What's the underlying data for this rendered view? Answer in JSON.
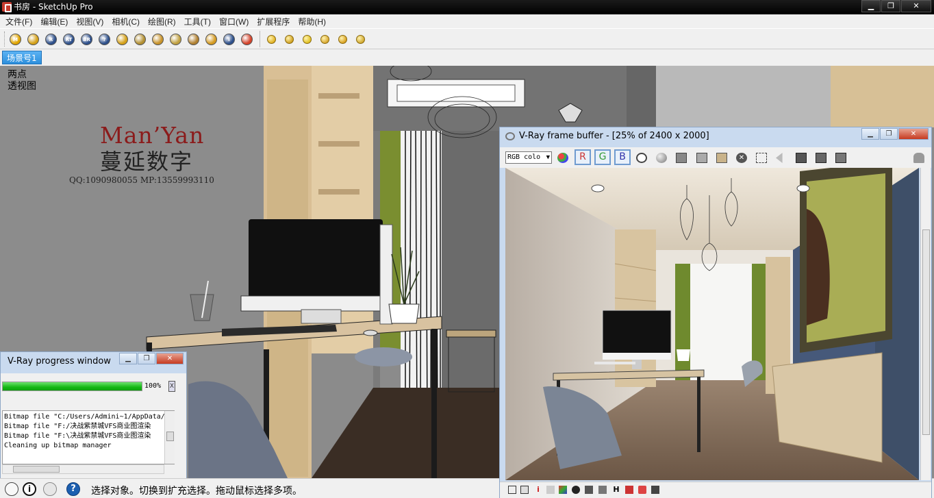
{
  "window": {
    "title": "书房 - SketchUp Pro",
    "btn_min": "▁",
    "btn_max": "❐",
    "btn_close": "✕"
  },
  "menu": [
    "文件(F)",
    "编辑(E)",
    "视图(V)",
    "相机(C)",
    "绘图(R)",
    "工具(T)",
    "窗口(W)",
    "扩展程序",
    "帮助(H)"
  ],
  "toolbar_icons": [
    {
      "name": "vray-material-editor-icon",
      "label": "M",
      "color": "#e0a400"
    },
    {
      "name": "vray-options-icon",
      "label": "",
      "color": "#d4a017"
    },
    {
      "name": "vray-render-icon",
      "label": "R",
      "color": "#2d4f8a"
    },
    {
      "name": "vray-rt-render-icon",
      "label": "RT",
      "color": "#2d4f8a"
    },
    {
      "name": "vray-batch-render-icon",
      "label": "BR",
      "color": "#2d4f8a"
    },
    {
      "name": "vray-help-icon",
      "label": "?",
      "color": "#2d4f8a"
    },
    {
      "name": "vray-frame-buffer-icon",
      "label": "",
      "color": "#d4a017"
    },
    {
      "name": "vray-export-icon",
      "label": "",
      "color": "#b39032"
    },
    {
      "name": "vray-light-cache-icon",
      "label": "",
      "color": "#c8932a"
    },
    {
      "name": "vray-proxy-icon",
      "label": "",
      "color": "#c0a040"
    },
    {
      "name": "vray-fur-icon",
      "label": "",
      "color": "#b08030"
    },
    {
      "name": "vray-sphere-icon",
      "label": "",
      "color": "#d49a20"
    },
    {
      "name": "vray-info-icon",
      "label": "i",
      "color": "#2d4f8a"
    },
    {
      "name": "vray-logo-icon",
      "label": "",
      "color": "#d4432a"
    }
  ],
  "toolbar_icons2": [
    {
      "name": "omni-light-icon",
      "color": "#e0b020"
    },
    {
      "name": "spot-light-icon",
      "color": "#d0a020"
    },
    {
      "name": "rect-light-icon",
      "color": "#e0c020"
    },
    {
      "name": "sphere-light-icon",
      "color": "#d8a830"
    },
    {
      "name": "ies-light-icon",
      "color": "#d8a020"
    },
    {
      "name": "dome-light-icon",
      "color": "#d0a830"
    }
  ],
  "scene_tab": "场景号1",
  "viewport": {
    "label_line1": "两点",
    "label_line2": "透视图"
  },
  "watermark": {
    "brand": "Man’Yan",
    "brand_cn": "蔓延数字",
    "contact": "QQ:1090980055    MP:13559993110"
  },
  "progress": {
    "title": "V-Ray progress window",
    "percent_text": "100%",
    "percent": 100,
    "close_label": "X",
    "log": [
      "Bitmap file \"C:/Users/Admini~1/AppData/",
      "Bitmap file \"F:/决战紫禁城VFS商业图渲染",
      "Bitmap file \"F:\\决战紫禁城VFS商业图渲染",
      "Cleaning up bitmap manager"
    ]
  },
  "vfb": {
    "title": "V-Ray frame buffer - [25% of 2400 x 2000]",
    "channel_select": "RGB colo",
    "r_label": "R",
    "g_label": "G",
    "b_label": "B"
  },
  "status": {
    "text": "选择对象。切换到扩充选择。拖动鼠标选择多项。"
  },
  "colors": {
    "accent": "#2d8fdc",
    "progress": "#15b815"
  }
}
